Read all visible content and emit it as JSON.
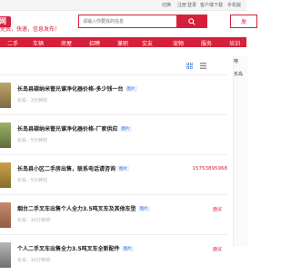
{
  "topbar": {
    "links": [
      "切换",
      "注册",
      "登录",
      "客户端下载",
      "手机版",
      "客户服务"
    ]
  },
  "logo": {
    "mark": "网",
    "slogan": "免费，快速，信息发布！"
  },
  "search": {
    "placeholder": "请输入你要找的信息"
  },
  "post_button": "发",
  "nav": {
    "items": [
      "二手",
      "车辆",
      "房屋",
      "招聘",
      "兼职",
      "交友",
      "宠物",
      "服务",
      "培训"
    ]
  },
  "sidebar": {
    "title": "特",
    "link": "长岛"
  },
  "listings": [
    {
      "title": "长岛县碳纳米管光谱净化器价格-多少钱一台",
      "badge": "图片",
      "sub": "长岛 · 3分钟前",
      "right": ""
    },
    {
      "title": "长岛县碳纳米管光谱净化器价格-厂家供应",
      "badge": "图片",
      "sub": "长岛 · 5分钟前",
      "right": ""
    },
    {
      "title": "长岛县小区二手房出售，联系电话请咨询",
      "badge": "图片",
      "sub": "长岛 · 5分钟前",
      "right": "15753895968"
    },
    {
      "title": "烟台二手叉车出售个人全力3.5吨叉车及其他车型",
      "badge": "图片",
      "sub": "长岛 · 10分钟前",
      "right": "面议"
    },
    {
      "title": "个人二手叉车出售全力3.5吨叉车全新配件",
      "badge": "图片",
      "sub": "长岛 · 10分钟前",
      "right": "面议"
    }
  ]
}
